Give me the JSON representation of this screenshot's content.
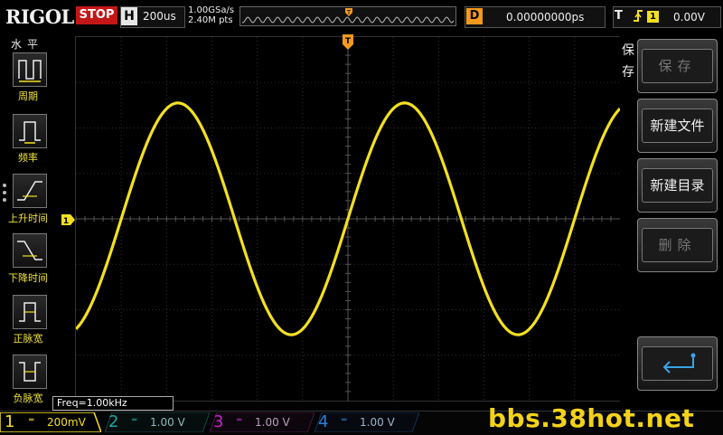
{
  "brand": "RIGOL",
  "run_status": "STOP",
  "horizontal": {
    "label": "H",
    "timebase": "200us"
  },
  "acquisition": {
    "sample_rate": "1.00GSa/s",
    "memory_depth": "2.40M pts"
  },
  "trigger_marker": "T",
  "delay": {
    "label": "D",
    "value": "0.00000000ps"
  },
  "trigger": {
    "label": "T",
    "edge_icon": "rising-edge-icon",
    "source": "1",
    "level": "0.00V"
  },
  "left_panel": {
    "title": "水平",
    "items": [
      {
        "label": "周期",
        "icon": "period-icon"
      },
      {
        "label": "频率",
        "icon": "frequency-icon"
      },
      {
        "label": "上升时间",
        "icon": "rise-time-icon"
      },
      {
        "label": "下降时间",
        "icon": "fall-time-icon"
      },
      {
        "label": "正脉宽",
        "icon": "positive-width-icon"
      },
      {
        "label": "负脉宽",
        "icon": "negative-width-icon"
      }
    ]
  },
  "waveform": {
    "channel": "1",
    "frequency_hz": 1000,
    "divisions_per_period": 5,
    "amplitude_divisions": 2.55,
    "channel_color": "#f3e021"
  },
  "freq_readout": "Freq=1.00kHz",
  "right_menu": {
    "title": "保存",
    "buttons": [
      {
        "label": "保存",
        "enabled": false
      },
      {
        "label": "新建文件",
        "enabled": true
      },
      {
        "label": "新建目录",
        "enabled": true
      },
      {
        "label": "删除",
        "enabled": false
      },
      {
        "label": "",
        "icon": "enter-icon",
        "enabled": true
      }
    ]
  },
  "channels": [
    {
      "num": "1",
      "scale": "200mV",
      "color": "#f3e021",
      "active": true
    },
    {
      "num": "2",
      "scale": "1.00 V",
      "color": "#1fa6a0",
      "active": false
    },
    {
      "num": "3",
      "scale": "1.00 V",
      "color": "#c71ed1",
      "active": false
    },
    {
      "num": "4",
      "scale": "1.00 V",
      "color": "#2b7fd6",
      "active": false
    }
  ],
  "watermark": "bbs.38hot.net",
  "colors": {
    "ch1": "#f3e021",
    "stop": "#c31717",
    "delay": "#f39a1e",
    "trigger_marker": "#f39a1e"
  }
}
